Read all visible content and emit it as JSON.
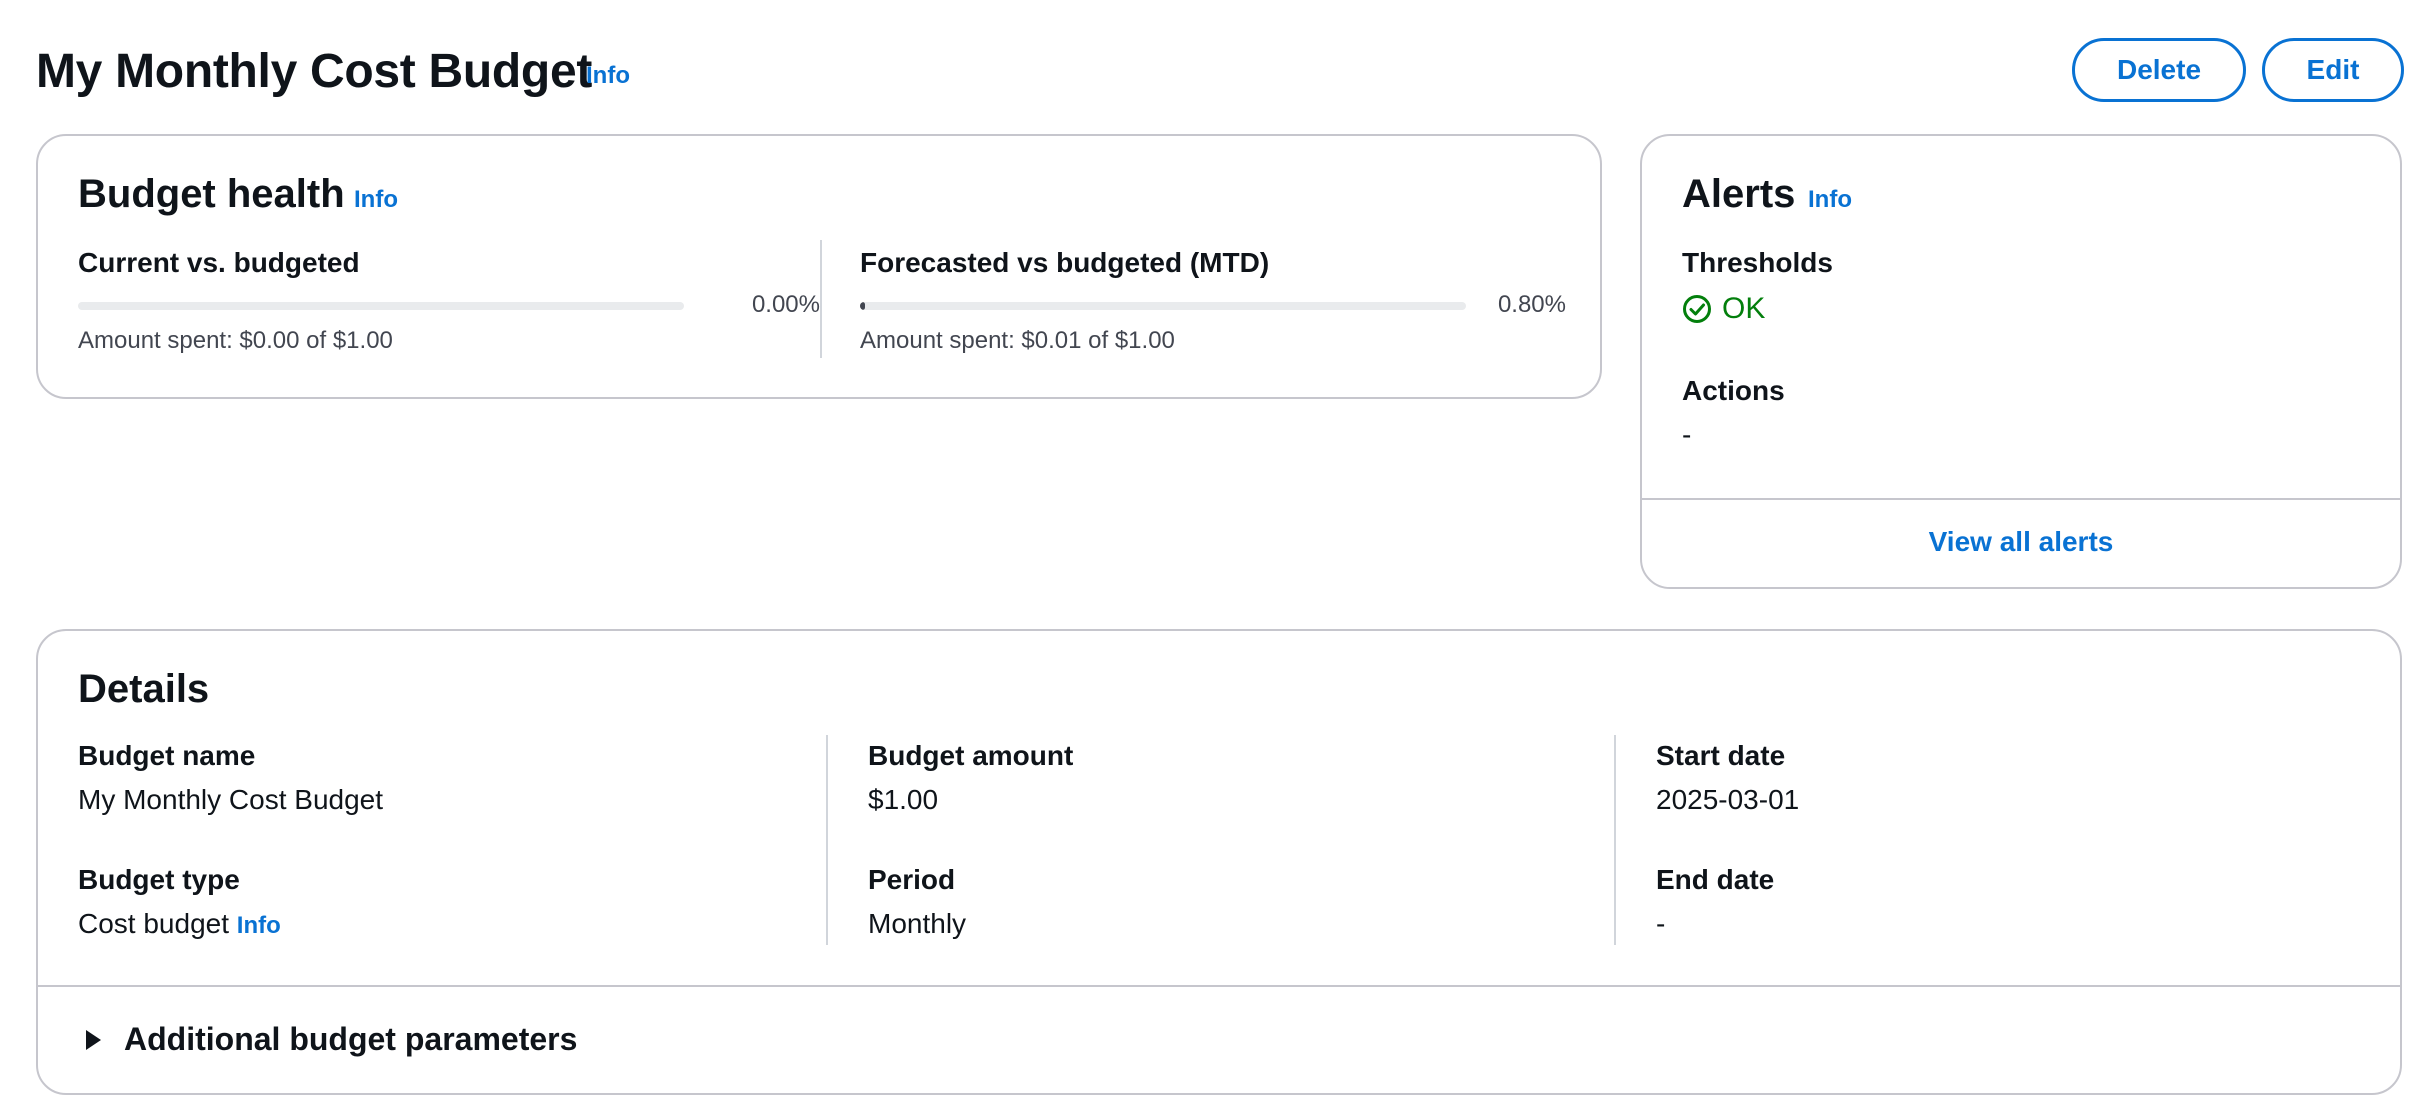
{
  "header": {
    "title": "My Monthly Cost Budget",
    "info": "Info",
    "delete_label": "Delete",
    "edit_label": "Edit"
  },
  "budget_health": {
    "title": "Budget health",
    "info": "Info",
    "current": {
      "label": "Current vs. budgeted",
      "percent_text": "0.00%",
      "progress_fraction": 0.0,
      "amount_text": "Amount spent: $0.00 of $1.00"
    },
    "forecast": {
      "label": "Forecasted vs budgeted (MTD)",
      "percent_text": "0.80%",
      "progress_fraction": 0.008,
      "amount_text": "Amount spent: $0.01 of $1.00"
    }
  },
  "alerts": {
    "title": "Alerts",
    "info": "Info",
    "thresholds_label": "Thresholds",
    "thresholds_status": "OK",
    "status_icon": "check-circle-icon",
    "actions_label": "Actions",
    "actions_value": "-",
    "view_all_label": "View all alerts"
  },
  "details": {
    "title": "Details",
    "budget_name_label": "Budget name",
    "budget_name_value": "My Monthly Cost Budget",
    "budget_type_label": "Budget type",
    "budget_type_value": "Cost budget",
    "budget_type_info": "Info",
    "budget_amount_label": "Budget amount",
    "budget_amount_value": "$1.00",
    "period_label": "Period",
    "period_value": "Monthly",
    "start_date_label": "Start date",
    "start_date_value": "2025-03-01",
    "end_date_label": "End date",
    "end_date_value": "-",
    "additional_params_label": "Additional budget parameters",
    "expander_icon": "caret-right-icon"
  },
  "colors": {
    "link": "#0972d3",
    "success": "#037f0c",
    "border": "#c6c6cd",
    "text": "#0f141a",
    "muted": "#424650",
    "progress_track": "#e9ebed"
  }
}
